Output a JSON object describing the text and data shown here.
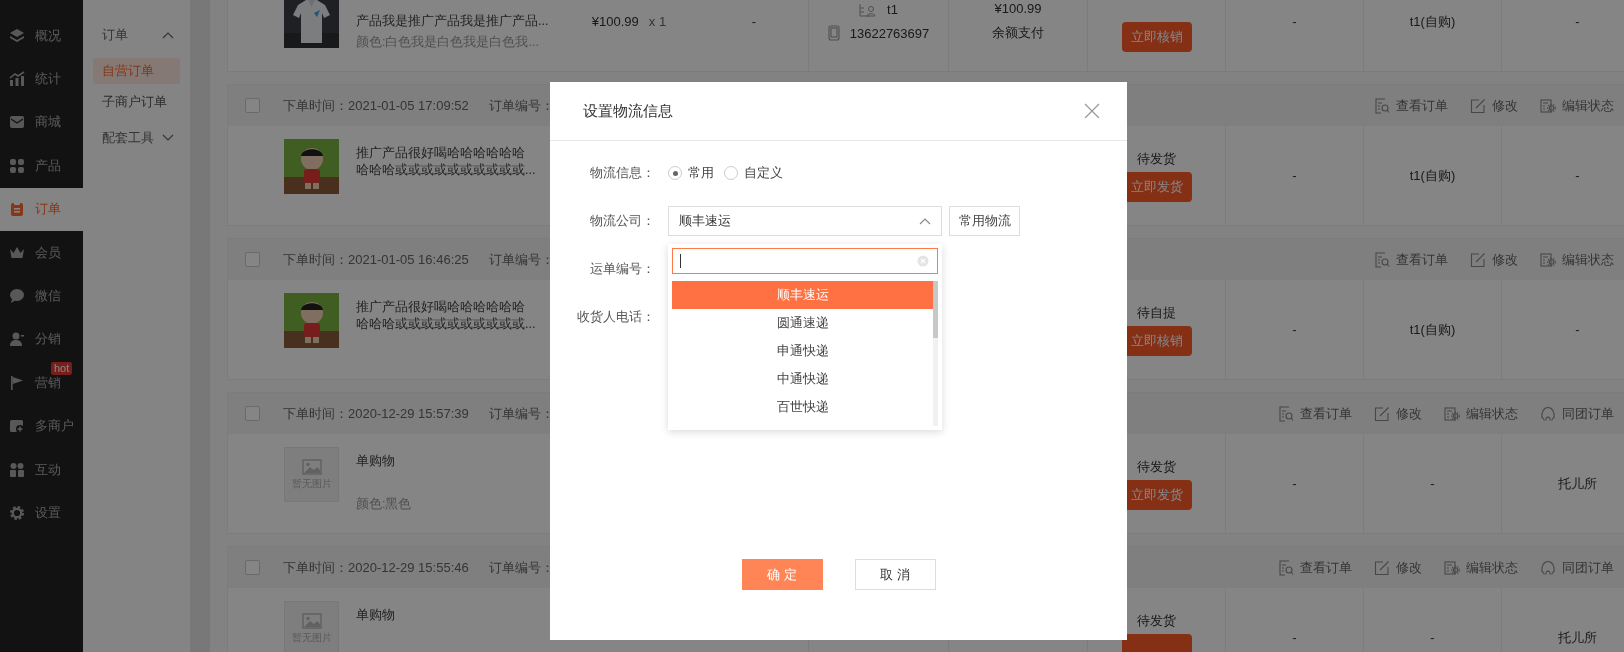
{
  "sidebar": {
    "items": [
      {
        "label": "概况",
        "selected": false
      },
      {
        "label": "统计",
        "selected": false
      },
      {
        "label": "商城",
        "selected": false
      },
      {
        "label": "产品",
        "selected": false
      },
      {
        "label": "订单",
        "selected": true
      },
      {
        "label": "会员",
        "selected": false
      },
      {
        "label": "微信",
        "selected": false
      },
      {
        "label": "分销",
        "selected": false
      },
      {
        "label": "营销",
        "selected": false,
        "badge": "hot"
      },
      {
        "label": "多商户",
        "selected": false
      },
      {
        "label": "互动",
        "selected": false
      },
      {
        "label": "设置",
        "selected": false
      }
    ]
  },
  "submenu": {
    "groups": [
      {
        "label": "订单",
        "expanded": true,
        "children": [
          {
            "label": "自营订单",
            "selected": true
          },
          {
            "label": "子商户订单",
            "selected": false
          }
        ]
      },
      {
        "label": "配套工具",
        "expanded": false
      }
    ]
  },
  "orders": [
    {
      "image": {
        "kind": "picture"
      },
      "title": "产品我是推广产品我是推广产品...",
      "variant": "颜色:白色我是白色我是白色我...",
      "price": "¥100.99",
      "quantity": "x 1",
      "column_5": "-",
      "buyer": {
        "name": "t1",
        "phone": "13622763697"
      },
      "payment": {
        "amount": "¥100.99",
        "method": "余额支付"
      },
      "status": {
        "button": "立即核销"
      },
      "column_9": "-",
      "column_10": "t1(自购)",
      "column_11": "-"
    },
    {
      "header": {
        "checked": false,
        "time": "下单时间：2021-01-05 17:09:52",
        "number_label": "订单编号：",
        "actions": [
          {
            "label": "查看订单",
            "kind": "view"
          },
          {
            "label": "修改",
            "kind": "edit"
          },
          {
            "label": "编辑状态",
            "kind": "status"
          }
        ]
      },
      "image": {
        "kind": "picture"
      },
      "title_lines": [
        "推广产品很好喝哈哈哈哈哈哈",
        "哈哈哈或或或或或或或或或或..."
      ],
      "status": {
        "label": "待发货",
        "button": "立即发货"
      },
      "column_9": "-",
      "column_10": "t1(自购)",
      "column_11": "-"
    },
    {
      "header": {
        "checked": false,
        "time": "下单时间：2021-01-05 16:46:25",
        "number_label": "订单编号：",
        "actions": [
          {
            "label": "查看订单",
            "kind": "view"
          },
          {
            "label": "修改",
            "kind": "edit"
          },
          {
            "label": "编辑状态",
            "kind": "status"
          }
        ]
      },
      "image": {
        "kind": "picture"
      },
      "title_lines": [
        "推广产品很好喝哈哈哈哈哈哈",
        "哈哈哈或或或或或或或或或或..."
      ],
      "status": {
        "label": "待自提",
        "button": "立即核销"
      },
      "column_9": "-",
      "column_10": "t1(自购)",
      "column_11": "-"
    },
    {
      "header": {
        "checked": false,
        "time": "下单时间：2020-12-29 15:57:39",
        "number_label": "订单编号：",
        "actions": [
          {
            "label": "查看订单",
            "kind": "view"
          },
          {
            "label": "修改",
            "kind": "edit"
          },
          {
            "label": "编辑状态",
            "kind": "status"
          },
          {
            "label": "同团订单",
            "kind": "group"
          }
        ]
      },
      "image": {
        "kind": "placeholder",
        "text": "暂无图片"
      },
      "title": "单购物",
      "variant": "颜色:黑色",
      "status": {
        "label": "待发货",
        "button": "立即发货"
      },
      "column_9": "-",
      "column_10": "-",
      "column_11": "托儿所"
    },
    {
      "header": {
        "checked": false,
        "time": "下单时间：2020-12-29 15:55:46",
        "number_label": "订单编号：",
        "actions": [
          {
            "label": "查看订单",
            "kind": "view"
          },
          {
            "label": "修改",
            "kind": "edit"
          },
          {
            "label": "编辑状态",
            "kind": "status"
          },
          {
            "label": "同团订单",
            "kind": "group"
          }
        ]
      },
      "image": {
        "kind": "placeholder",
        "text": "暂无图片"
      },
      "title": "单购物",
      "status": {
        "label": "待发货"
      },
      "column_9": "-",
      "column_10": "-",
      "column_11": "托儿所"
    }
  ],
  "dialog": {
    "title": "设置物流信息",
    "fields": [
      {
        "label": "物流信息：",
        "kind": "radio",
        "options": [
          {
            "label": "常用",
            "selected": true
          },
          {
            "label": "自定义",
            "selected": false
          }
        ]
      },
      {
        "label": "物流公司：",
        "kind": "select",
        "value": "顺丰速运",
        "expanded": true,
        "button": "常用物流",
        "options": [
          {
            "label": "顺丰速运",
            "selected": true
          },
          {
            "label": "圆通速递",
            "selected": false
          },
          {
            "label": "申通快递",
            "selected": false
          },
          {
            "label": "中通快递",
            "selected": false
          },
          {
            "label": "百世快递",
            "selected": false
          }
        ]
      },
      {
        "label": "运单编号："
      },
      {
        "label": "收货人电话："
      }
    ],
    "buttons": [
      {
        "label": "确 定",
        "kind": "primary"
      },
      {
        "label": "取 消",
        "kind": "default"
      }
    ]
  }
}
